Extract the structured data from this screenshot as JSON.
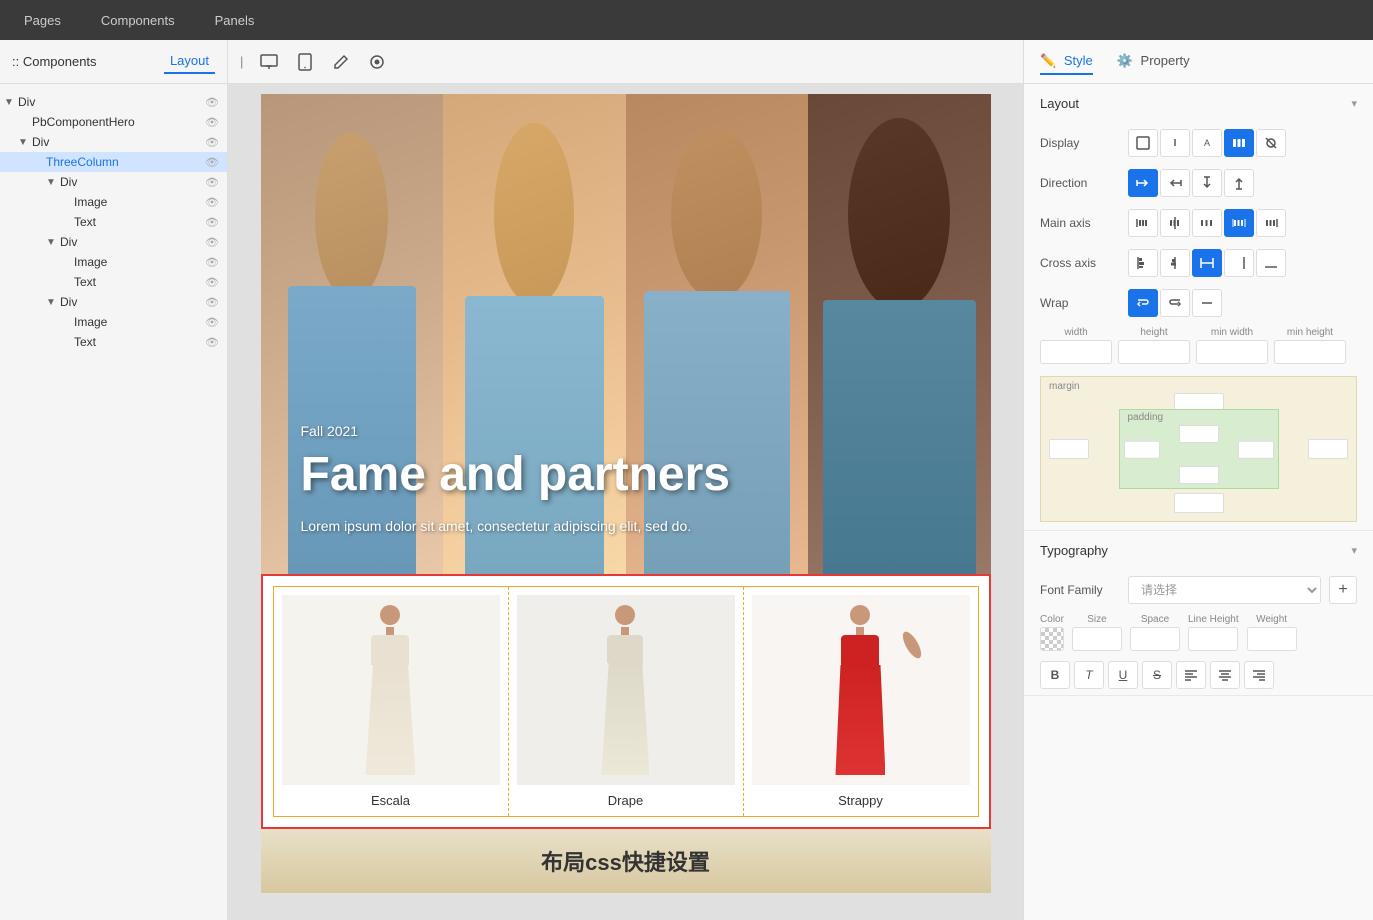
{
  "topNav": {
    "items": [
      "Pages",
      "Components",
      "Panels"
    ]
  },
  "sidebar": {
    "header": {
      "componentsLabel": ":: Components",
      "layoutTab": "Layout"
    },
    "tree": [
      {
        "id": "div-1",
        "label": "Div",
        "depth": 0,
        "hasArrow": true,
        "expanded": true
      },
      {
        "id": "pbcomponent",
        "label": "PbComponentHero",
        "depth": 1,
        "hasArrow": false
      },
      {
        "id": "div-2",
        "label": "Div",
        "depth": 1,
        "hasArrow": true,
        "expanded": true
      },
      {
        "id": "threecolumn",
        "label": "ThreeColumn",
        "depth": 2,
        "hasArrow": false,
        "selected": true
      },
      {
        "id": "div-3",
        "label": "Div",
        "depth": 3,
        "hasArrow": true,
        "expanded": false
      },
      {
        "id": "image-1",
        "label": "Image",
        "depth": 4,
        "hasArrow": false
      },
      {
        "id": "text-1",
        "label": "Text",
        "depth": 4,
        "hasArrow": false
      },
      {
        "id": "div-4",
        "label": "Div",
        "depth": 3,
        "hasArrow": true,
        "expanded": false
      },
      {
        "id": "image-2",
        "label": "Image",
        "depth": 4,
        "hasArrow": false
      },
      {
        "id": "text-2",
        "label": "Text",
        "depth": 4,
        "hasArrow": false
      },
      {
        "id": "div-5",
        "label": "Div",
        "depth": 3,
        "hasArrow": true,
        "expanded": false
      },
      {
        "id": "image-3",
        "label": "Image",
        "depth": 4,
        "hasArrow": false
      },
      {
        "id": "text-3",
        "label": "Text",
        "depth": 4,
        "hasArrow": false
      }
    ]
  },
  "canvasToolbar": {
    "icons": [
      "desktop",
      "tablet",
      "edit",
      "preview"
    ]
  },
  "hero": {
    "subtitle": "Fall 2021",
    "title": "Fame and partners",
    "description": "Lorem ipsum dolor sit amet, consectetur adipiscing elit, sed do."
  },
  "products": {
    "items": [
      {
        "name": "Escala",
        "color": "cream"
      },
      {
        "name": "Drape",
        "color": "cream"
      },
      {
        "name": "Strappy",
        "color": "red"
      }
    ]
  },
  "bottomBanner": {
    "text": "布局css快捷设置"
  },
  "rightPanel": {
    "tabs": [
      "Style",
      "Property"
    ],
    "activeTab": "Style",
    "layout": {
      "title": "Layout",
      "display": {
        "label": "Display",
        "options": [
          "block",
          "inline",
          "inline-block",
          "flex",
          "hidden"
        ],
        "active": 3
      },
      "direction": {
        "label": "Direction",
        "options": [
          "row",
          "row-reverse",
          "col",
          "col-reverse"
        ],
        "active": 0
      },
      "mainAxis": {
        "label": "Main axis",
        "options": [
          "start",
          "center",
          "between",
          "around",
          "end"
        ],
        "active": 3
      },
      "crossAxis": {
        "label": "Cross axis",
        "options": [
          "start",
          "center",
          "stretch",
          "end",
          "baseline"
        ],
        "active": 2
      },
      "wrap": {
        "label": "Wrap",
        "options": [
          "wrap",
          "wrap-reverse",
          "nowrap"
        ],
        "active": 0
      },
      "dimensions": {
        "width": {
          "label": "width",
          "value": ""
        },
        "height": {
          "label": "height",
          "value": ""
        },
        "minWidth": {
          "label": "min width",
          "value": ""
        },
        "minHeight": {
          "label": "min height",
          "value": ""
        }
      },
      "margin": {
        "label": "margin",
        "value": ""
      },
      "padding": {
        "label": "padding",
        "value": ""
      }
    },
    "typography": {
      "title": "Typography",
      "fontFamily": {
        "label": "Font Family",
        "placeholder": "请选择"
      },
      "color": {
        "label": "Color"
      },
      "size": {
        "label": "Size",
        "value": ""
      },
      "space": {
        "label": "Space",
        "value": ""
      },
      "lineHeight": {
        "label": "Line Height",
        "value": ""
      },
      "weight": {
        "label": "Weight",
        "value": ""
      }
    }
  }
}
